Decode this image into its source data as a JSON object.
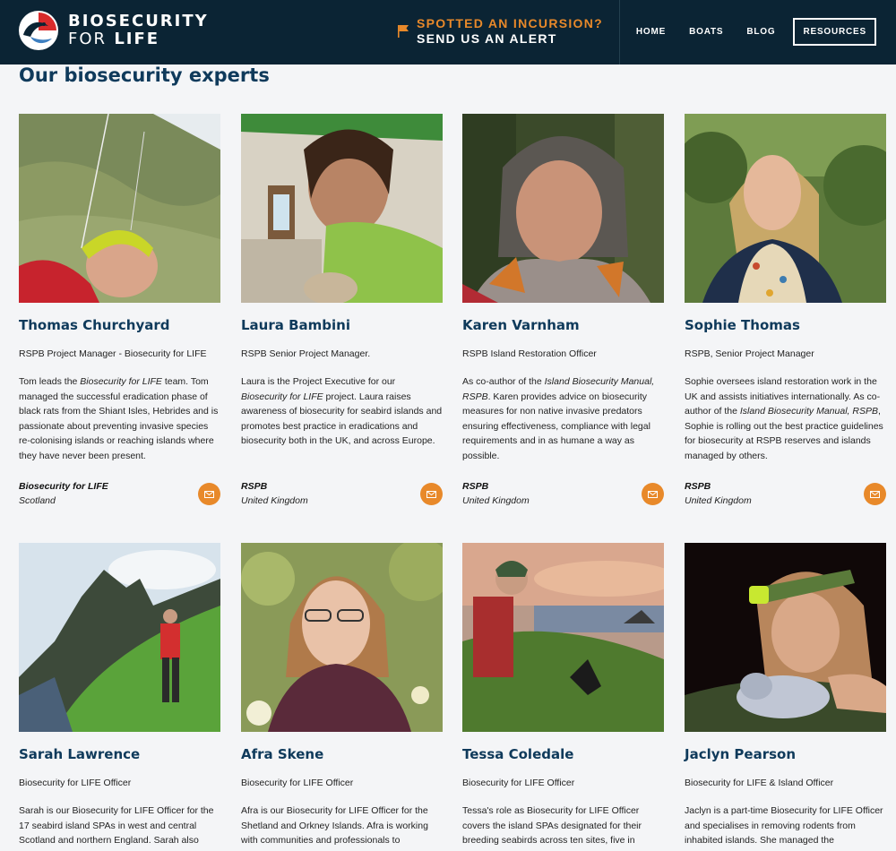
{
  "header": {
    "logo_line1": "BIOSECURITY",
    "logo_line2a": "FOR",
    "logo_line2b": "LIFE",
    "alert_line1": "SPOTTED AN INCURSION?",
    "alert_line2": "SEND US AN ALERT",
    "nav": [
      "HOME",
      "BOATS",
      "BLOG"
    ],
    "resources_label": "RESOURCES"
  },
  "section_title": "Our biosecurity experts",
  "colors": {
    "header_bg": "#0b2434",
    "accent_orange": "#e8892a",
    "title_blue": "#0f3a5b"
  },
  "experts": [
    {
      "name": "Thomas Churchyard",
      "role": "RSPB Project Manager - Biosecurity for LIFE",
      "bio_a": "Tom leads the ",
      "bio_em": "Biosecurity for LIFE",
      "bio_b": " team. Tom managed the successful eradication phase of black rats from the Shiant Isles, Hebrides and is passionate about preventing invasive species re-colonising islands or reaching islands where they have never been present.",
      "org": "Biosecurity for LIFE",
      "country": "Scotland"
    },
    {
      "name": "Laura Bambini",
      "role": "RSPB Senior Project Manager.",
      "bio_a": "Laura is the Project Executive for our ",
      "bio_em": "Biosecurity for LIFE",
      "bio_b": " project. Laura raises awareness of biosecurity for seabird islands and promotes best practice in eradications and biosecurity both in the UK, and across Europe.",
      "org": "RSPB",
      "country": "United Kingdom"
    },
    {
      "name": "Karen Varnham",
      "role": "RSPB Island Restoration Officer",
      "bio_a": "As co-author of the ",
      "bio_em": "Island Biosecurity Manual, RSPB",
      "bio_b": ". Karen provides advice on biosecurity measures for non native invasive predators ensuring effectiveness, compliance with legal requirements and in as humane a way as possible.",
      "org": "RSPB",
      "country": "United Kingdom"
    },
    {
      "name": "Sophie Thomas",
      "role": "RSPB, Senior Project Manager",
      "bio_a": "Sophie oversees island restoration work in the UK and assists initiatives internationally. As co-author of the ",
      "bio_em": "Island Biosecurity Manual, RSPB",
      "bio_b": ", Sophie is rolling out the best practice guidelines for biosecurity at RSPB reserves and islands managed by others.",
      "org": "RSPB",
      "country": "United Kingdom"
    },
    {
      "name": "Sarah Lawrence",
      "role": "Biosecurity for LIFE Officer",
      "bio_a": "Sarah is our Biosecurity for LIFE Officer for the 17 seabird island SPAs in west and central Scotland and northern England. Sarah also",
      "bio_em": "",
      "bio_b": ""
    },
    {
      "name": "Afra Skene",
      "role": "Biosecurity for LIFE Officer",
      "bio_a": "Afra is our Biosecurity for LIFE Officer for the Shetland and Orkney Islands. Afra is working with communities and professionals to",
      "bio_em": "",
      "bio_b": ""
    },
    {
      "name": "Tessa Coledale",
      "role": "Biosecurity for LIFE Officer",
      "bio_a": "Tessa's role as Biosecurity for LIFE Officer covers the island SPAs designated for their breeding seabirds across ten sites, five in",
      "bio_em": "",
      "bio_b": ""
    },
    {
      "name": "Jaclyn Pearson",
      "role": "Biosecurity for LIFE & Island Officer",
      "bio_a": "Jaclyn is a part-time Biosecurity for LIFE Officer and specialises in removing rodents from inhabited islands. She managed the",
      "bio_em": "",
      "bio_b": ""
    }
  ]
}
